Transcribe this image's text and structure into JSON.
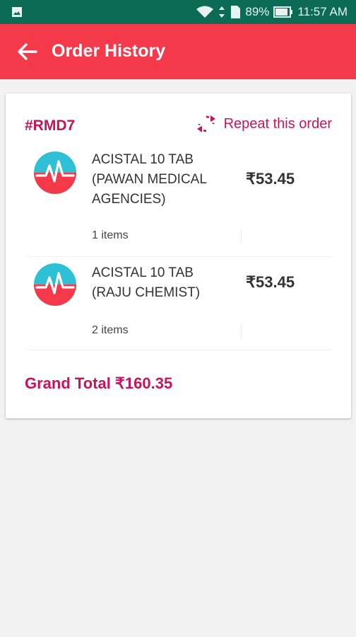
{
  "status_bar": {
    "battery": "89%",
    "time": "11:57 AM"
  },
  "app_bar": {
    "title": "Order History"
  },
  "order": {
    "id": "#RMD7",
    "repeat_label": "Repeat this order",
    "items": [
      {
        "name": "ACISTAL 10 TAB (PAWAN MEDICAL AGENCIES)",
        "price": "₹53.45",
        "count": "1 items"
      },
      {
        "name": "ACISTAL 10 TAB (RAJU CHEMIST)",
        "price": "₹53.45",
        "count": "2 items"
      }
    ],
    "grand_total": "Grand Total ₹160.35"
  },
  "colors": {
    "status_bar": "#0b6b54",
    "app_bar": "#f4394b",
    "accent": "#c8135a",
    "logo_teal": "#2ec1d6",
    "logo_red": "#f4394b"
  },
  "icons": {
    "back": "arrow-left-icon",
    "repeat": "refresh-icon",
    "item_logo": "heartbeat-logo-icon"
  }
}
